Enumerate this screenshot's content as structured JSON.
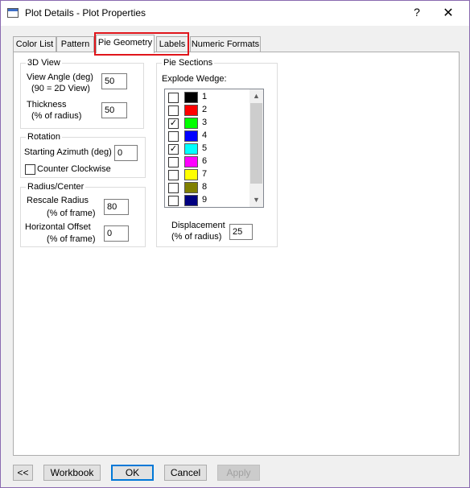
{
  "window": {
    "title": "Plot Details - Plot Properties",
    "help": "?",
    "close": "✕"
  },
  "tabs": [
    "Color List",
    "Pattern",
    "Pie Geometry",
    "Labels",
    "Numeric Formats"
  ],
  "view3d": {
    "legend": "3D View",
    "view_angle_label_1": "View Angle (deg)",
    "view_angle_label_2": "(90 = 2D View)",
    "view_angle_value": "50",
    "thickness_label_1": "Thickness",
    "thickness_label_2": "(% of radius)",
    "thickness_value": "50"
  },
  "rotation": {
    "legend": "Rotation",
    "azimuth_label": "Starting Azimuth (deg)",
    "azimuth_value": "0",
    "ccw_label": "Counter Clockwise",
    "ccw_checked": false
  },
  "radius": {
    "legend": "Radius/Center",
    "rescale_label_1": "Rescale Radius",
    "rescale_label_2": "(% of frame)",
    "rescale_value": "80",
    "hoffset_label_1": "Horizontal Offset",
    "hoffset_label_2": "(% of frame)",
    "hoffset_value": "0"
  },
  "pie_sections": {
    "legend": "Pie Sections",
    "explode_label": "Explode Wedge:",
    "wedges": [
      {
        "num": "1",
        "color": "#000000",
        "checked": false
      },
      {
        "num": "2",
        "color": "#ff0000",
        "checked": false
      },
      {
        "num": "3",
        "color": "#00ff00",
        "checked": true
      },
      {
        "num": "4",
        "color": "#0000ff",
        "checked": false
      },
      {
        "num": "5",
        "color": "#00ffff",
        "checked": true
      },
      {
        "num": "6",
        "color": "#ff00ff",
        "checked": false
      },
      {
        "num": "7",
        "color": "#ffff00",
        "checked": false
      },
      {
        "num": "8",
        "color": "#808000",
        "checked": false
      },
      {
        "num": "9",
        "color": "#000080",
        "checked": false
      }
    ],
    "displacement_label_1": "Displacement",
    "displacement_label_2": "(% of radius)",
    "displacement_value": "25"
  },
  "buttons": {
    "back": "<<",
    "workbook": "Workbook",
    "ok": "OK",
    "cancel": "Cancel",
    "apply": "Apply"
  }
}
